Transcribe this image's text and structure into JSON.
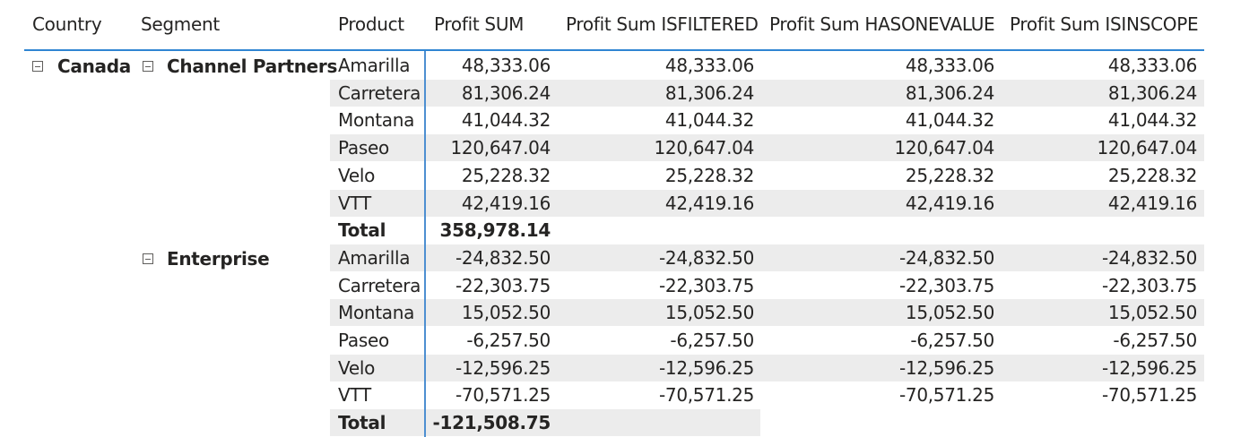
{
  "columns": {
    "country": "Country",
    "segment": "Segment",
    "product": "Product",
    "profit_sum": "Profit SUM",
    "isfiltered": "Profit Sum ISFILTERED",
    "hasonevalue": "Profit Sum HASONEVALUE",
    "isinscope": "Profit Sum ISINSCOPE"
  },
  "country": "Canada",
  "segments": [
    {
      "name": "Channel Partners",
      "rows": [
        {
          "product": "Amarilla",
          "profit_sum": "48,333.06",
          "isfiltered": "48,333.06",
          "hasonevalue": "48,333.06",
          "isinscope": "48,333.06"
        },
        {
          "product": "Carretera",
          "profit_sum": "81,306.24",
          "isfiltered": "81,306.24",
          "hasonevalue": "81,306.24",
          "isinscope": "81,306.24"
        },
        {
          "product": "Montana",
          "profit_sum": "41,044.32",
          "isfiltered": "41,044.32",
          "hasonevalue": "41,044.32",
          "isinscope": "41,044.32"
        },
        {
          "product": "Paseo",
          "profit_sum": "120,647.04",
          "isfiltered": "120,647.04",
          "hasonevalue": "120,647.04",
          "isinscope": "120,647.04"
        },
        {
          "product": "Velo",
          "profit_sum": "25,228.32",
          "isfiltered": "25,228.32",
          "hasonevalue": "25,228.32",
          "isinscope": "25,228.32"
        },
        {
          "product": "VTT",
          "profit_sum": "42,419.16",
          "isfiltered": "42,419.16",
          "hasonevalue": "42,419.16",
          "isinscope": "42,419.16"
        }
      ],
      "total_label": "Total",
      "total_profit_sum": "358,978.14"
    },
    {
      "name": "Enterprise",
      "rows": [
        {
          "product": "Amarilla",
          "profit_sum": "-24,832.50",
          "isfiltered": "-24,832.50",
          "hasonevalue": "-24,832.50",
          "isinscope": "-24,832.50"
        },
        {
          "product": "Carretera",
          "profit_sum": "-22,303.75",
          "isfiltered": "-22,303.75",
          "hasonevalue": "-22,303.75",
          "isinscope": "-22,303.75"
        },
        {
          "product": "Montana",
          "profit_sum": "15,052.50",
          "isfiltered": "15,052.50",
          "hasonevalue": "15,052.50",
          "isinscope": "15,052.50"
        },
        {
          "product": "Paseo",
          "profit_sum": "-6,257.50",
          "isfiltered": "-6,257.50",
          "hasonevalue": "-6,257.50",
          "isinscope": "-6,257.50"
        },
        {
          "product": "Velo",
          "profit_sum": "-12,596.25",
          "isfiltered": "-12,596.25",
          "hasonevalue": "-12,596.25",
          "isinscope": "-12,596.25"
        },
        {
          "product": "VTT",
          "profit_sum": "-70,571.25",
          "isfiltered": "-70,571.25",
          "hasonevalue": "-70,571.25",
          "isinscope": "-70,571.25"
        }
      ],
      "total_label": "Total",
      "total_profit_sum": "-121,508.75"
    }
  ],
  "colors": {
    "header_rule": "#2f85d2",
    "divider": "#4d8fd1",
    "row_shade": "#ececec",
    "text": "#252423"
  },
  "icons": {
    "expander": "collapse-minus-box-icon"
  }
}
